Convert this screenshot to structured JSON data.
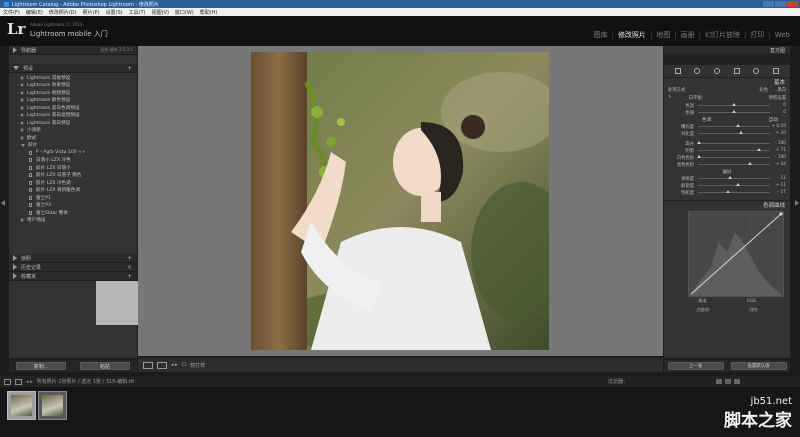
{
  "window": {
    "title": "Lightroom Catalog - Adobe Photoshop Lightroom - 修改照片"
  },
  "menu": [
    "文件(F)",
    "编辑(E)",
    "修改照片(D)",
    "照片(P)",
    "设置(S)",
    "工具(T)",
    "视图(V)",
    "窗口(W)",
    "帮助(H)"
  ],
  "identity": {
    "logo": "Lr",
    "catalog_name": "Adobe Lightroom CC 2015",
    "mobile_label": "Lightroom mobile 入门"
  },
  "modules": [
    {
      "label": "图库",
      "active": false
    },
    {
      "label": "修改照片",
      "active": true
    },
    {
      "label": "地图",
      "active": false
    },
    {
      "label": "画册",
      "active": false
    },
    {
      "label": "幻灯片放映",
      "active": false
    },
    {
      "label": "打印",
      "active": false
    },
    {
      "label": "Web",
      "active": false
    }
  ],
  "left_panel": {
    "navigator": {
      "label": "导航器",
      "options": "适合  填充  1:1  3:1"
    },
    "presets": {
      "label": "预设",
      "items": [
        {
          "label": "Lightroom 常规预设",
          "kind": "folder"
        },
        {
          "label": "Lightroom 效果预设",
          "kind": "folder"
        },
        {
          "label": "Lightroom 视频预设",
          "kind": "folder"
        },
        {
          "label": "Lightroom 颜色预设",
          "kind": "folder"
        },
        {
          "label": "Lightroom 黑白色调预设",
          "kind": "folder"
        },
        {
          "label": "Lightroom 黑白滤镜预设",
          "kind": "folder"
        },
        {
          "label": "Lightroom 黑白预设",
          "kind": "folder"
        },
        {
          "label": "小清新",
          "kind": "folder"
        },
        {
          "label": "欧式",
          "kind": "folder"
        },
        {
          "label": "胶片",
          "kind": "open"
        },
        {
          "label": "F - Agfa Vista 100 ++",
          "kind": "preset"
        },
        {
          "label": "日落小 LZX 冷色",
          "kind": "preset"
        },
        {
          "label": "胶片 LZX 日落小",
          "kind": "preset"
        },
        {
          "label": "胶片 LZX 日落子 糖色",
          "kind": "preset"
        },
        {
          "label": "胶片 LZX 冷色调",
          "kind": "preset"
        },
        {
          "label": "胶片 LZX 清新暖色调",
          "kind": "preset"
        },
        {
          "label": "富士P1",
          "kind": "preset"
        },
        {
          "label": "富士P3",
          "kind": "preset"
        },
        {
          "label": "富士Ektar 整体",
          "kind": "preset"
        },
        {
          "label": "用户预设",
          "kind": "folder"
        }
      ]
    },
    "snapshots": {
      "label": "快照"
    },
    "history": {
      "label": "历史记录"
    },
    "collections": {
      "label": "收藏夹"
    },
    "copy_button": "复制...",
    "paste_button": "粘贴"
  },
  "toolbar": {
    "soft_proof": "软打样"
  },
  "right_panel": {
    "histogram_label": "直方图",
    "basic": {
      "title": "基本",
      "treatment_label": "处理方式：",
      "treatment_options": [
        "彩色",
        "黑白"
      ],
      "white_balance_label": "白平衡：",
      "white_balance_value": "原照设置",
      "wb_rows": [
        {
          "label": "色温",
          "value": "0",
          "pos": 0.5
        },
        {
          "label": "色调",
          "value": "0",
          "pos": 0.5
        }
      ],
      "tone_label": "色调",
      "tone_auto": "自动",
      "tone_rows": [
        {
          "label": "曝光度",
          "value": "+ 0.19",
          "pos": 0.55
        },
        {
          "label": "对比度",
          "value": "+ 20",
          "pos": 0.6
        }
      ],
      "highlight_rows": [
        {
          "label": "高光",
          "value": "- 100",
          "pos": 0.02
        },
        {
          "label": "阴影",
          "value": "+ 71",
          "pos": 0.85
        },
        {
          "label": "白色色阶",
          "value": "- 100",
          "pos": 0.02
        },
        {
          "label": "黑色色阶",
          "value": "+ 44",
          "pos": 0.72
        }
      ],
      "presence_label": "偏好",
      "presence_rows": [
        {
          "label": "清晰度",
          "value": "- 11",
          "pos": 0.44
        },
        {
          "label": "鲜艳度",
          "value": "+ 11",
          "pos": 0.56
        },
        {
          "label": "饱和度",
          "value": "- 17",
          "pos": 0.41
        }
      ]
    },
    "tone_curve": {
      "title": "色调曲线",
      "channel_label": "通道",
      "channel_value": "RGB",
      "point_curve_label": "点曲线：",
      "point_curve_value": "线性"
    },
    "previous_button": "上一张",
    "reset_button": "设置默认值"
  },
  "filmstrip": {
    "path": "所有照片  2张照片 / 选定 1张 / 315-编辑.tif",
    "filter_label": "过滤器："
  },
  "watermark": {
    "site": "jb51.net",
    "brand": "脚本之家"
  }
}
